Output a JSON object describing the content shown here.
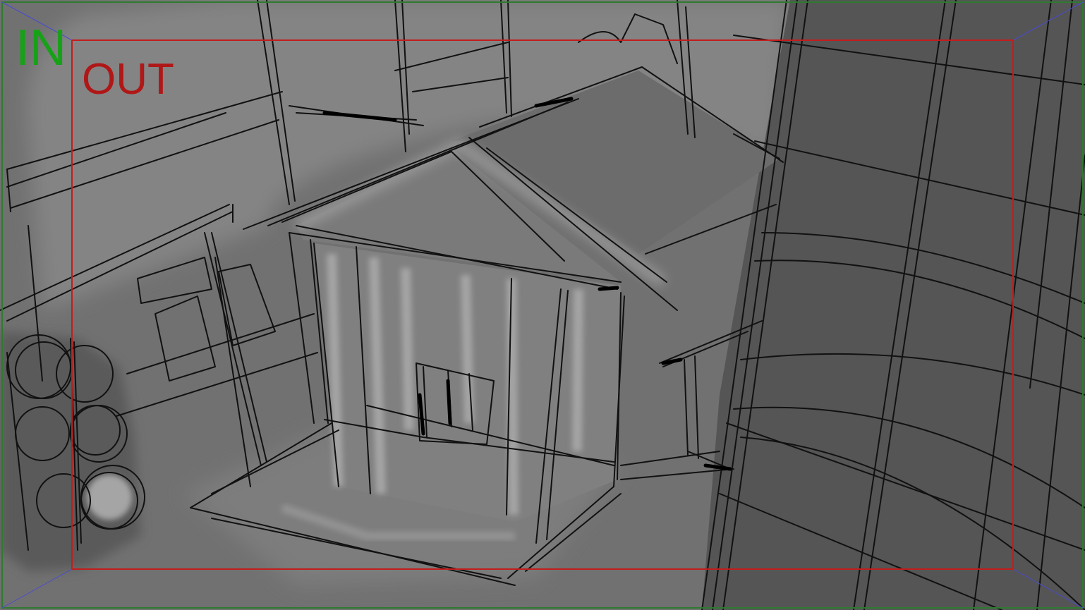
{
  "frame_labels": {
    "in_label": "IN",
    "out_label": "OUT"
  },
  "colors": {
    "in_frame": "#2f7a2f",
    "out_frame": "#c41c1c",
    "in_label": "#17a117",
    "out_label": "#b01717",
    "corner_guides": "#4a4ad0",
    "sketch_line": "#101010",
    "backdrop": "#6f6f6f"
  }
}
